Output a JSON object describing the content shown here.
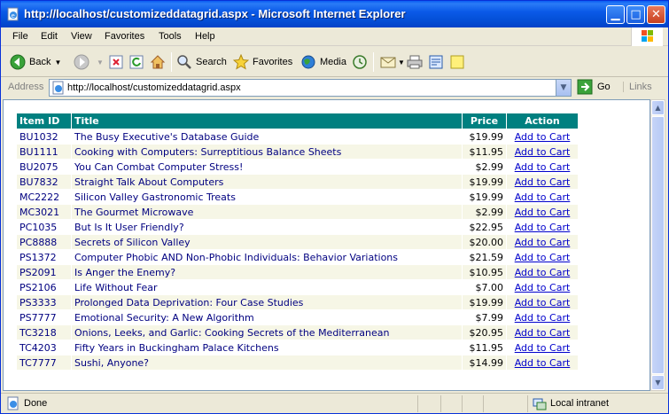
{
  "window": {
    "title": "http://localhost/customizeddatagrid.aspx - Microsoft Internet Explorer",
    "minimize_icon": "minimize-icon",
    "maximize_icon": "maximize-icon",
    "close_icon": "close-icon"
  },
  "menu": {
    "items": [
      {
        "first": "F",
        "rest": "ile"
      },
      {
        "first": "E",
        "rest": "dit"
      },
      {
        "first": "V",
        "rest": "iew"
      },
      {
        "first": "F",
        "rest": "avorites",
        "prefix": "F",
        "special": true
      },
      {
        "first": "T",
        "rest": "ools"
      },
      {
        "first": "H",
        "rest": "elp"
      }
    ],
    "labels": [
      "File",
      "Edit",
      "View",
      "Favorites",
      "Tools",
      "Help"
    ]
  },
  "toolbar": {
    "back": "Back",
    "search": "Search",
    "favorites": "Favorites",
    "media": "Media"
  },
  "address": {
    "label": "Address",
    "url": "http://localhost/customizeddatagrid.aspx",
    "go": "Go",
    "links": "Links"
  },
  "grid": {
    "headers": {
      "id": "Item ID",
      "title": "Title",
      "price": "Price",
      "action": "Action"
    },
    "header_color": "#008080",
    "alt_row_color": "#f6f6e6",
    "action_label": "Add to Cart",
    "rows": [
      {
        "id": "BU1032",
        "title": "The Busy Executive's Database Guide",
        "price": "$19.99"
      },
      {
        "id": "BU1111",
        "title": "Cooking with Computers: Surreptitious Balance Sheets",
        "price": "$11.95"
      },
      {
        "id": "BU2075",
        "title": "You Can Combat Computer Stress!",
        "price": "$2.99"
      },
      {
        "id": "BU7832",
        "title": "Straight Talk About Computers",
        "price": "$19.99"
      },
      {
        "id": "MC2222",
        "title": "Silicon Valley Gastronomic Treats",
        "price": "$19.99"
      },
      {
        "id": "MC3021",
        "title": "The Gourmet Microwave",
        "price": "$2.99"
      },
      {
        "id": "PC1035",
        "title": "But Is It User Friendly?",
        "price": "$22.95"
      },
      {
        "id": "PC8888",
        "title": "Secrets of Silicon Valley",
        "price": "$20.00"
      },
      {
        "id": "PS1372",
        "title": "Computer Phobic AND Non-Phobic Individuals: Behavior Variations",
        "price": "$21.59"
      },
      {
        "id": "PS2091",
        "title": "Is Anger the Enemy?",
        "price": "$10.95"
      },
      {
        "id": "PS2106",
        "title": "Life Without Fear",
        "price": "$7.00"
      },
      {
        "id": "PS3333",
        "title": "Prolonged Data Deprivation: Four Case Studies",
        "price": "$19.99"
      },
      {
        "id": "PS7777",
        "title": "Emotional Security: A New Algorithm",
        "price": "$7.99"
      },
      {
        "id": "TC3218",
        "title": "Onions, Leeks, and Garlic: Cooking Secrets of the Mediterranean",
        "price": "$20.95"
      },
      {
        "id": "TC4203",
        "title": "Fifty Years in Buckingham Palace Kitchens",
        "price": "$11.95"
      },
      {
        "id": "TC7777",
        "title": "Sushi, Anyone?",
        "price": "$14.99"
      }
    ]
  },
  "status": {
    "text": "Done",
    "zone": "Local intranet"
  }
}
